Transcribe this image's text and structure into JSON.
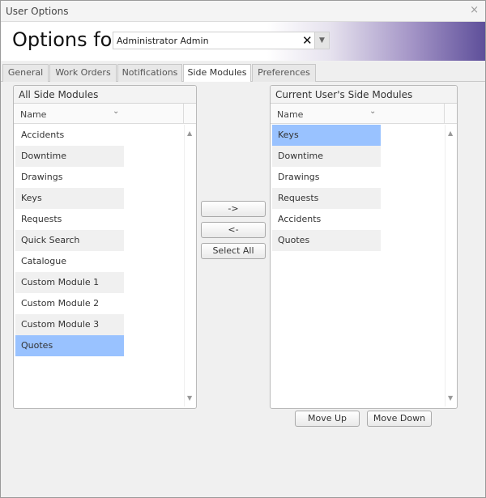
{
  "window": {
    "title": "User Options",
    "close_label": "×"
  },
  "banner": {
    "title": "Options for",
    "user_value": "Administrator Admin",
    "clear_label": "✕",
    "dropdown_label": "▼"
  },
  "tabs": [
    {
      "label": "General"
    },
    {
      "label": "Work Orders"
    },
    {
      "label": "Notifications"
    },
    {
      "label": "Side Modules"
    },
    {
      "label": "Preferences"
    }
  ],
  "left_panel": {
    "title": "All Side Modules",
    "column": "Name",
    "items": [
      "Accidents",
      "Downtime",
      "Drawings",
      "Keys",
      "Requests",
      "Quick Search",
      "Catalogue",
      "Custom Module 1",
      "Custom Module 2",
      "Custom Module 3",
      "Quotes"
    ]
  },
  "right_panel": {
    "title": "Current User's Side Modules",
    "column": "Name",
    "items": [
      "Keys",
      "Downtime",
      "Drawings",
      "Requests",
      "Accidents",
      "Quotes"
    ]
  },
  "transfer": {
    "add_label": "->",
    "remove_label": "<-",
    "select_all_label": "Select All"
  },
  "order": {
    "move_up_label": "Move Up",
    "move_down_label": "Move Down"
  },
  "icons": {
    "chevron": "chevron-down-icon",
    "scroll_up": "scroll-up-icon",
    "scroll_down": "scroll-down-icon"
  },
  "colors": {
    "selection": "#99c2ff",
    "banner_end": "#5e4f9a"
  }
}
